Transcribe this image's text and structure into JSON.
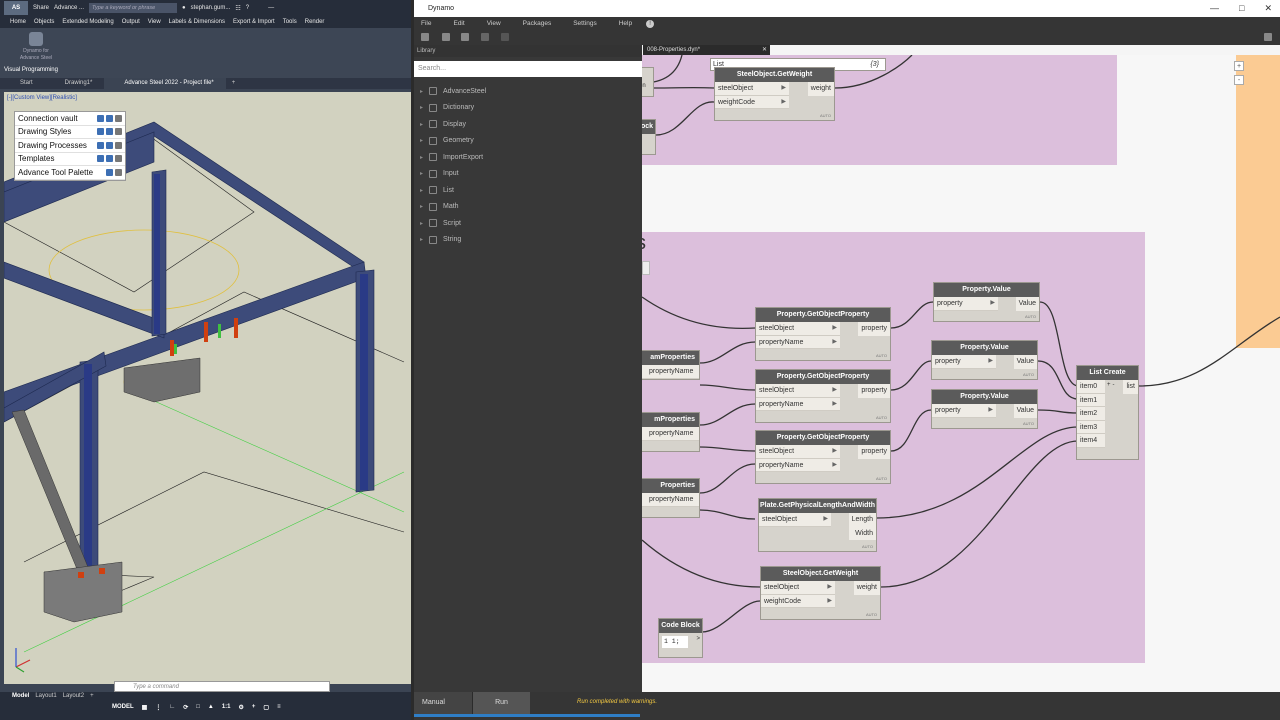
{
  "advance_steel": {
    "title_bar": {
      "logo": "AS",
      "app_title": "Advance ...",
      "share": "Share",
      "search_placeholder": "Type a keyword or phrase",
      "user": "stephan.gum..."
    },
    "menu": [
      "Home",
      "Objects",
      "Extended Modeling",
      "Output",
      "View",
      "Labels & Dimensions",
      "Export & Import",
      "Tools",
      "Render"
    ],
    "ribbon": {
      "dynamo_button": "Dynamo for Advance Steel",
      "panel_label": "Visual Programming"
    },
    "doc_tabs": [
      "Start",
      "Drawing1*",
      "Advance Steel 2022 - Project file*"
    ],
    "viewport_label": "[-][Custom View][Realistic]",
    "tool_palette": [
      {
        "label": "Connection vault"
      },
      {
        "label": "Drawing Styles"
      },
      {
        "label": "Drawing Processes"
      },
      {
        "label": "Templates"
      },
      {
        "label": "Advance Tool Palette"
      }
    ],
    "command_placeholder": "Type a command",
    "layout_tabs": [
      "Model",
      "Layout1",
      "Layout2"
    ],
    "status_model": "MODEL",
    "scale": "1:1"
  },
  "dynamo": {
    "title": "Dynamo",
    "menu": [
      "File",
      "Edit",
      "View",
      "Packages",
      "Settings",
      "Help"
    ],
    "file_tab": "008-Properties.dyn*",
    "library": {
      "header": "Library",
      "search_placeholder": "Search...",
      "categories": [
        "AdvanceSteel",
        "Dictionary",
        "Display",
        "Geometry",
        "ImportExport",
        "Input",
        "List",
        "Math",
        "Script",
        "String"
      ]
    },
    "group_title": "s",
    "nodes": {
      "gw_top": {
        "title": "SteelObject.GetWeight",
        "inputs": [
          "steelObject",
          "weightCode"
        ],
        "output": "weight"
      },
      "gop1": {
        "title": "Property.GetObjectProperty",
        "inputs": [
          "steelObject",
          "propertyName"
        ],
        "output": "property"
      },
      "gop2": {
        "title": "Property.GetObjectProperty",
        "inputs": [
          "steelObject",
          "propertyName"
        ],
        "output": "property"
      },
      "gop3": {
        "title": "Property.GetObjectProperty",
        "inputs": [
          "steelObject",
          "propertyName"
        ],
        "output": "property"
      },
      "pv1": {
        "title": "Property.Value",
        "input": "property",
        "output": "Value"
      },
      "pv2": {
        "title": "Property.Value",
        "input": "property",
        "output": "Value"
      },
      "pv3": {
        "title": "Property.Value",
        "input": "property",
        "output": "Value"
      },
      "plate": {
        "title": "Plate.GetPhysicalLengthAndWidth",
        "input": "steelObject",
        "outputs": [
          "Length",
          "Width"
        ]
      },
      "gw_bot": {
        "title": "SteelObject.GetWeight",
        "inputs": [
          "steelObject",
          "weightCode"
        ],
        "output": "weight"
      },
      "list_create": {
        "title": "List Create",
        "inputs": [
          "item0",
          "item1",
          "item2",
          "item3",
          "item4"
        ],
        "output": "list"
      },
      "code_block": {
        "title": "Code Block",
        "code": "1 1;"
      },
      "partial_a": {
        "label": "amProperties",
        "input": "propertyName"
      },
      "partial_b": {
        "label": "mProperties",
        "input": "propertyName"
      },
      "partial_c": {
        "label": "Properties",
        "input": "propertyName"
      },
      "partial_top_a": {
        "label": "on"
      },
      "partial_top_b": {
        "label": "ock"
      },
      "list_watch": {
        "label": "List",
        "count": "{3}"
      }
    },
    "auto_label": "AUTO",
    "bottom": {
      "run_mode": "Manual",
      "run_button": "Run",
      "status": "Run completed with warnings."
    }
  }
}
